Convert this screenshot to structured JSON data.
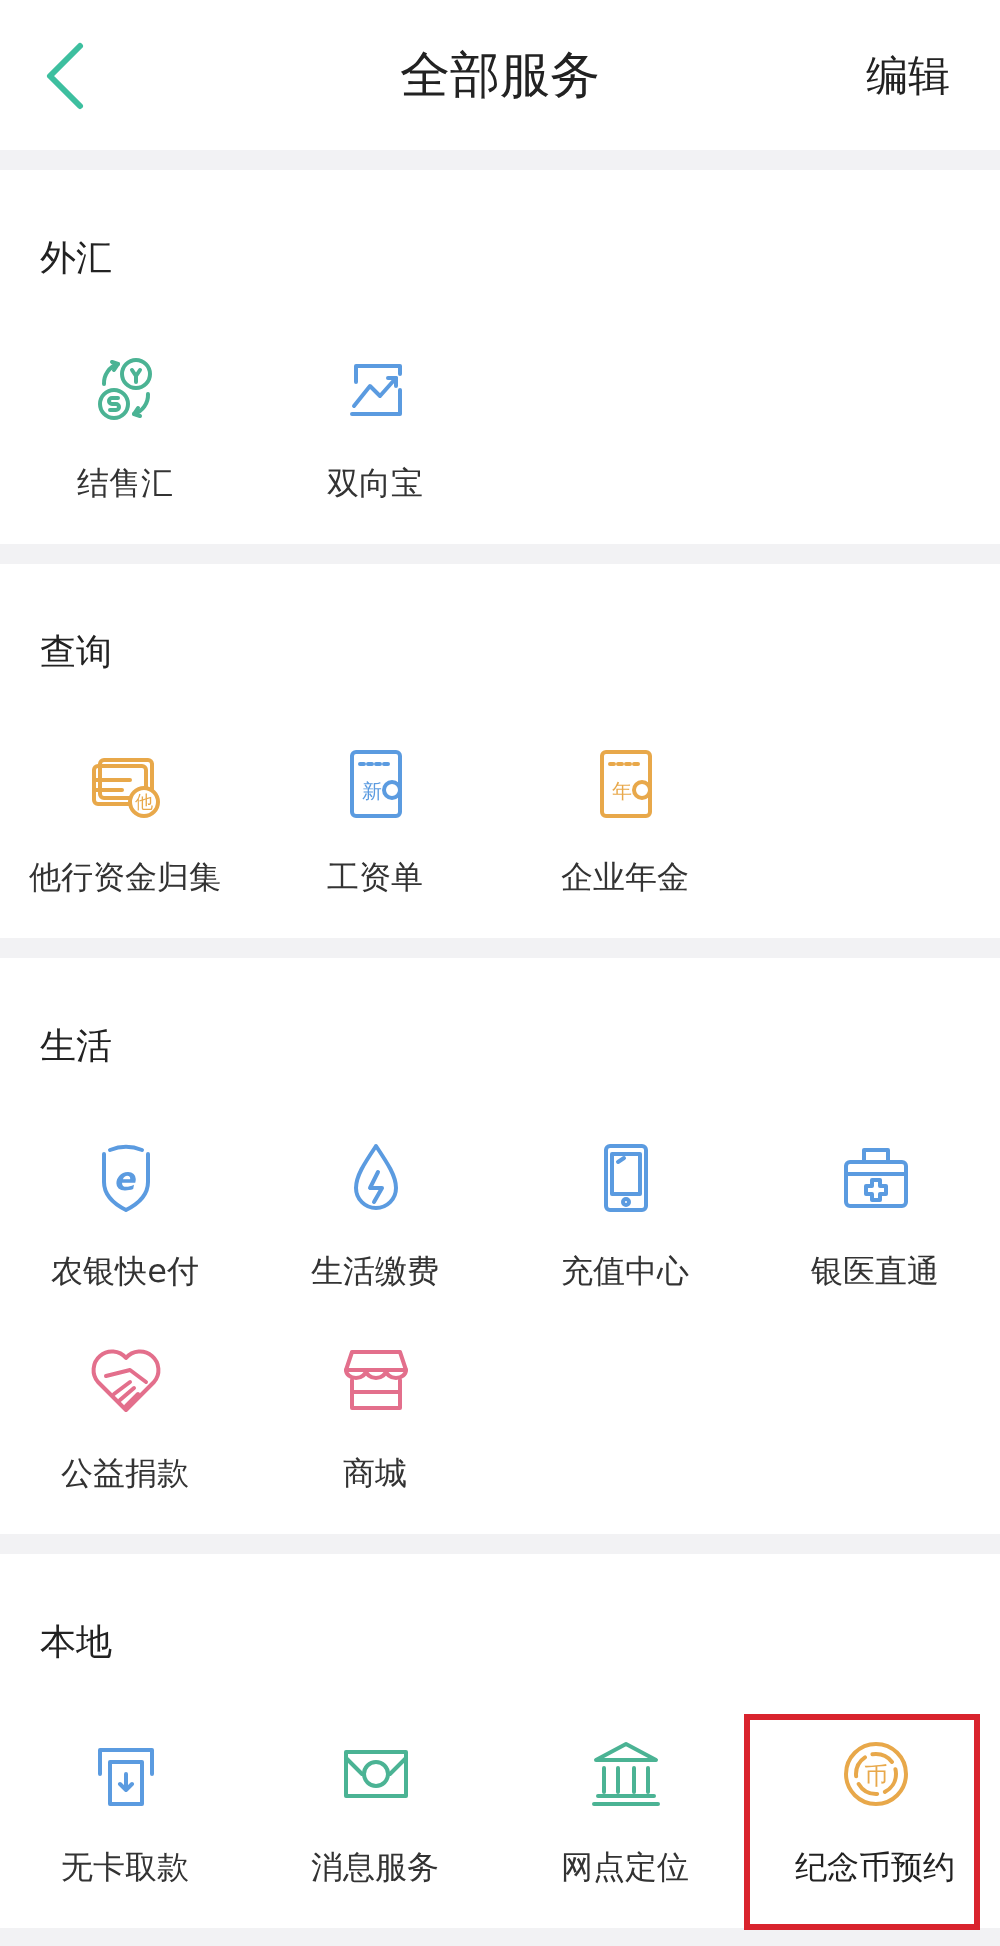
{
  "header": {
    "title": "全部服务",
    "action": "编辑"
  },
  "sections": [
    {
      "title": "外汇",
      "items": [
        {
          "label": "结售汇",
          "kind": "exchange",
          "color": "#4bb394",
          "highlighted": false
        },
        {
          "label": "双向宝",
          "kind": "chart",
          "color": "#5b9be0",
          "highlighted": false
        }
      ]
    },
    {
      "title": "查询",
      "items": [
        {
          "label": "他行资金归集",
          "kind": "cards",
          "icon_text": "他",
          "color": "#e8a84a",
          "highlighted": false
        },
        {
          "label": "工资单",
          "kind": "document",
          "icon_text": "新",
          "color": "#5b9be0",
          "highlighted": false
        },
        {
          "label": "企业年金",
          "kind": "document",
          "icon_text": "年",
          "color": "#e8a84a",
          "highlighted": false
        }
      ]
    },
    {
      "title": "生活",
      "items": [
        {
          "label": "农银快e付",
          "kind": "shield",
          "icon_text": "e",
          "color": "#5b9be0",
          "highlighted": false
        },
        {
          "label": "生活缴费",
          "kind": "drop",
          "color": "#5b9be0",
          "highlighted": false
        },
        {
          "label": "充值中心",
          "kind": "phone",
          "color": "#5b9be0",
          "highlighted": false
        },
        {
          "label": "银医直通",
          "kind": "medkit",
          "color": "#5b9be0",
          "highlighted": false
        },
        {
          "label": "公益捐款",
          "kind": "heart",
          "color": "#e36f8c",
          "highlighted": false
        },
        {
          "label": "商城",
          "kind": "store",
          "color": "#e36f8c",
          "highlighted": false
        }
      ]
    },
    {
      "title": "本地",
      "items": [
        {
          "label": "无卡取款",
          "kind": "atm",
          "color": "#5b9be0",
          "highlighted": false
        },
        {
          "label": "消息服务",
          "kind": "envelope",
          "color": "#4bb394",
          "highlighted": false
        },
        {
          "label": "网点定位",
          "kind": "bank",
          "color": "#4bb394",
          "highlighted": false
        },
        {
          "label": "纪念币预约",
          "kind": "coin",
          "icon_text": "币",
          "color": "#e8a84a",
          "highlighted": true
        }
      ]
    }
  ]
}
